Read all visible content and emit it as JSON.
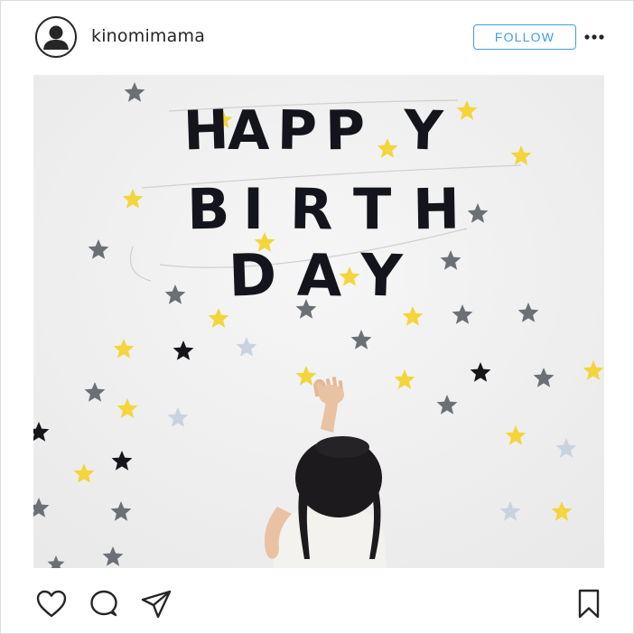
{
  "post": {
    "username": "kinomimama",
    "follow_label": "FOLLOW"
  },
  "photo": {
    "banner_line1": [
      "H",
      "A",
      "P",
      "P",
      "Y"
    ],
    "banner_line2": [
      "B",
      "I",
      "R",
      "T",
      "H"
    ],
    "banner_line3": [
      "D",
      "A",
      "Y"
    ]
  },
  "icons": {
    "avatar": "user-avatar-icon",
    "more": "more-options-icon",
    "like": "heart-icon",
    "comment": "comment-icon",
    "share": "send-icon",
    "save": "bookmark-icon"
  },
  "colors": {
    "accent": "#3ea0d8",
    "text": "#262626",
    "letter": "#14141c",
    "star_yellow": "#f3d53c",
    "star_gray": "#6b7076",
    "star_black": "#16161a",
    "star_light": "#c9d3df"
  }
}
